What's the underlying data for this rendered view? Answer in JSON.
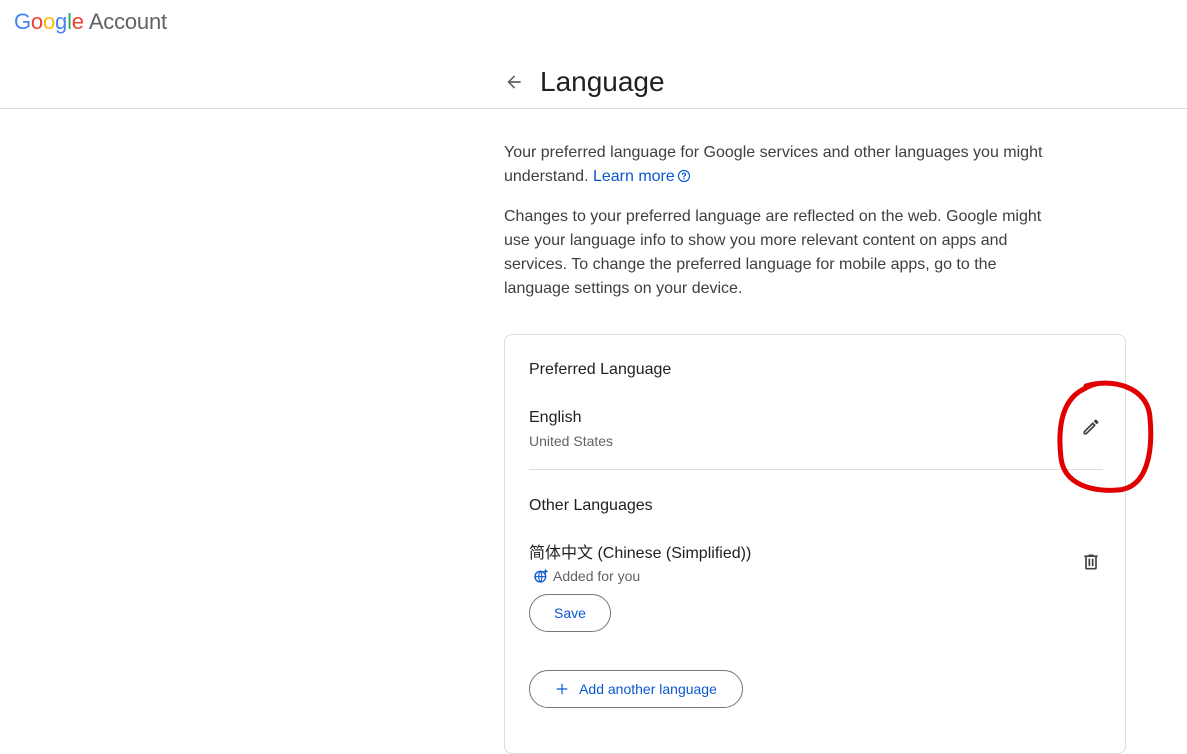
{
  "logo": {
    "letters": [
      "G",
      "o",
      "o",
      "g",
      "l",
      "e"
    ],
    "account": "Account"
  },
  "header": {
    "back_icon": "arrow-back-icon",
    "title": "Language"
  },
  "intro": {
    "p1_text": "Your preferred language for Google services and other languages you might understand. ",
    "learn_more": "Learn more",
    "help_icon": "help-circle-icon",
    "p2_text": "Changes to your preferred language are reflected on the web. Google might use your language info to show you more relevant content on apps and services. To change the preferred language for mobile apps, go to the language settings on your device."
  },
  "card": {
    "preferred": {
      "title": "Preferred Language",
      "language": "English",
      "region": "United States",
      "edit_icon": "pencil-icon"
    },
    "other": {
      "title": "Other Languages",
      "language": "简体中文 (Chinese (Simplified))",
      "added_icon": "language-sparkle-icon",
      "added_text": "Added for you",
      "delete_icon": "trash-icon",
      "save_label": "Save"
    },
    "add_icon": "plus-icon",
    "add_label": "Add another language"
  },
  "colors": {
    "accent": "#0b57d0",
    "annotation": "#e00000",
    "divider": "#dadce0"
  }
}
